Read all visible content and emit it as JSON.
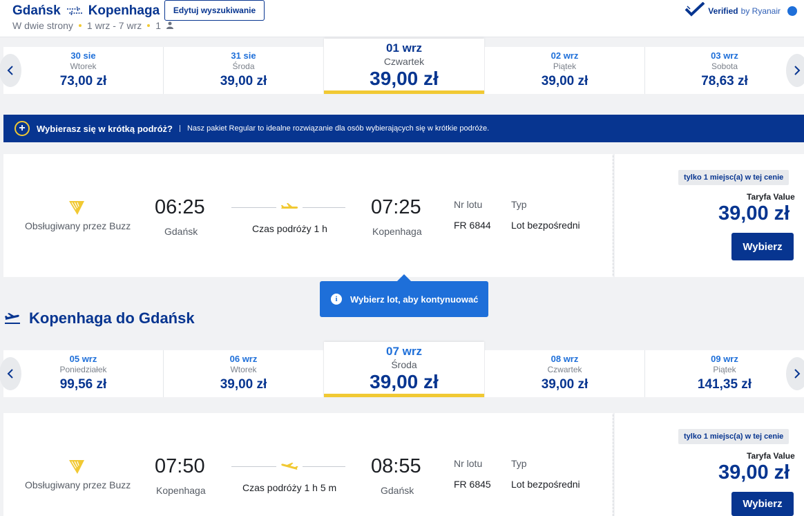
{
  "header": {
    "origin": "Gdańsk",
    "destination": "Kopenhaga",
    "trip_type": "W dwie strony",
    "dates": "1 wrz - 7 wrz",
    "passengers": "1",
    "edit_label": "Edytuj wyszukiwanie",
    "verified_label": "Verified",
    "verified_by": "by Ryanair"
  },
  "outbound_dates": [
    {
      "date": "30 sie",
      "day": "Wtorek",
      "price": "73,00 zł"
    },
    {
      "date": "31 sie",
      "day": "Środa",
      "price": "39,00 zł"
    },
    {
      "date": "01 wrz",
      "day": "Czwartek",
      "price": "39,00 zł",
      "selected": true
    },
    {
      "date": "02 wrz",
      "day": "Piątek",
      "price": "39,00 zł"
    },
    {
      "date": "03 wrz",
      "day": "Sobota",
      "price": "78,63 zł"
    }
  ],
  "banner": {
    "title": "Wybierasz się w krótką podróż?",
    "text": "Nasz pakiet Regular to idealne rozwiązanie dla osób wybierających się w krótkie podróże."
  },
  "outbound_flight": {
    "operator": "Obsługiwany przez Buzz",
    "dep_time": "06:25",
    "dep_city": "Gdańsk",
    "duration": "Czas podróży 1 h",
    "arr_time": "07:25",
    "arr_city": "Kopenhaga",
    "flight_no_label": "Nr lotu",
    "flight_no": "FR 6844",
    "type_label": "Typ",
    "type": "Lot bezpośredni",
    "seats": "tylko 1 miejsc(a) w tej cenie",
    "fare_name": "Taryfa Value",
    "price": "39,00 zł",
    "select_label": "Wybierz"
  },
  "tooltip": {
    "text": "Wybierz lot, aby kontynuować"
  },
  "return_heading": "Kopenhaga do Gdańsk",
  "return_dates": [
    {
      "date": "05 wrz",
      "day": "Poniedziałek",
      "price": "99,56 zł"
    },
    {
      "date": "06 wrz",
      "day": "Wtorek",
      "price": "39,00 zł"
    },
    {
      "date": "07 wrz",
      "day": "Środa",
      "price": "39,00 zł",
      "selected": true
    },
    {
      "date": "08 wrz",
      "day": "Czwartek",
      "price": "39,00 zł"
    },
    {
      "date": "09 wrz",
      "day": "Piątek",
      "price": "141,35 zł"
    }
  ],
  "return_flight": {
    "operator": "Obsługiwany przez Buzz",
    "dep_time": "07:50",
    "dep_city": "Kopenhaga",
    "duration": "Czas podróży 1 h 5 m",
    "arr_time": "08:55",
    "arr_city": "Gdańsk",
    "flight_no_label": "Nr lotu",
    "flight_no": "FR 6845",
    "type_label": "Typ",
    "type": "Lot bezpośredni",
    "seats": "tylko 1 miejsc(a) w tej cenie",
    "fare_name": "Taryfa Value",
    "price": "39,00 zł",
    "select_label": "Wybierz"
  },
  "colors": {
    "brand": "#073590",
    "accent": "#f1c933",
    "link": "#1e6fd9"
  }
}
